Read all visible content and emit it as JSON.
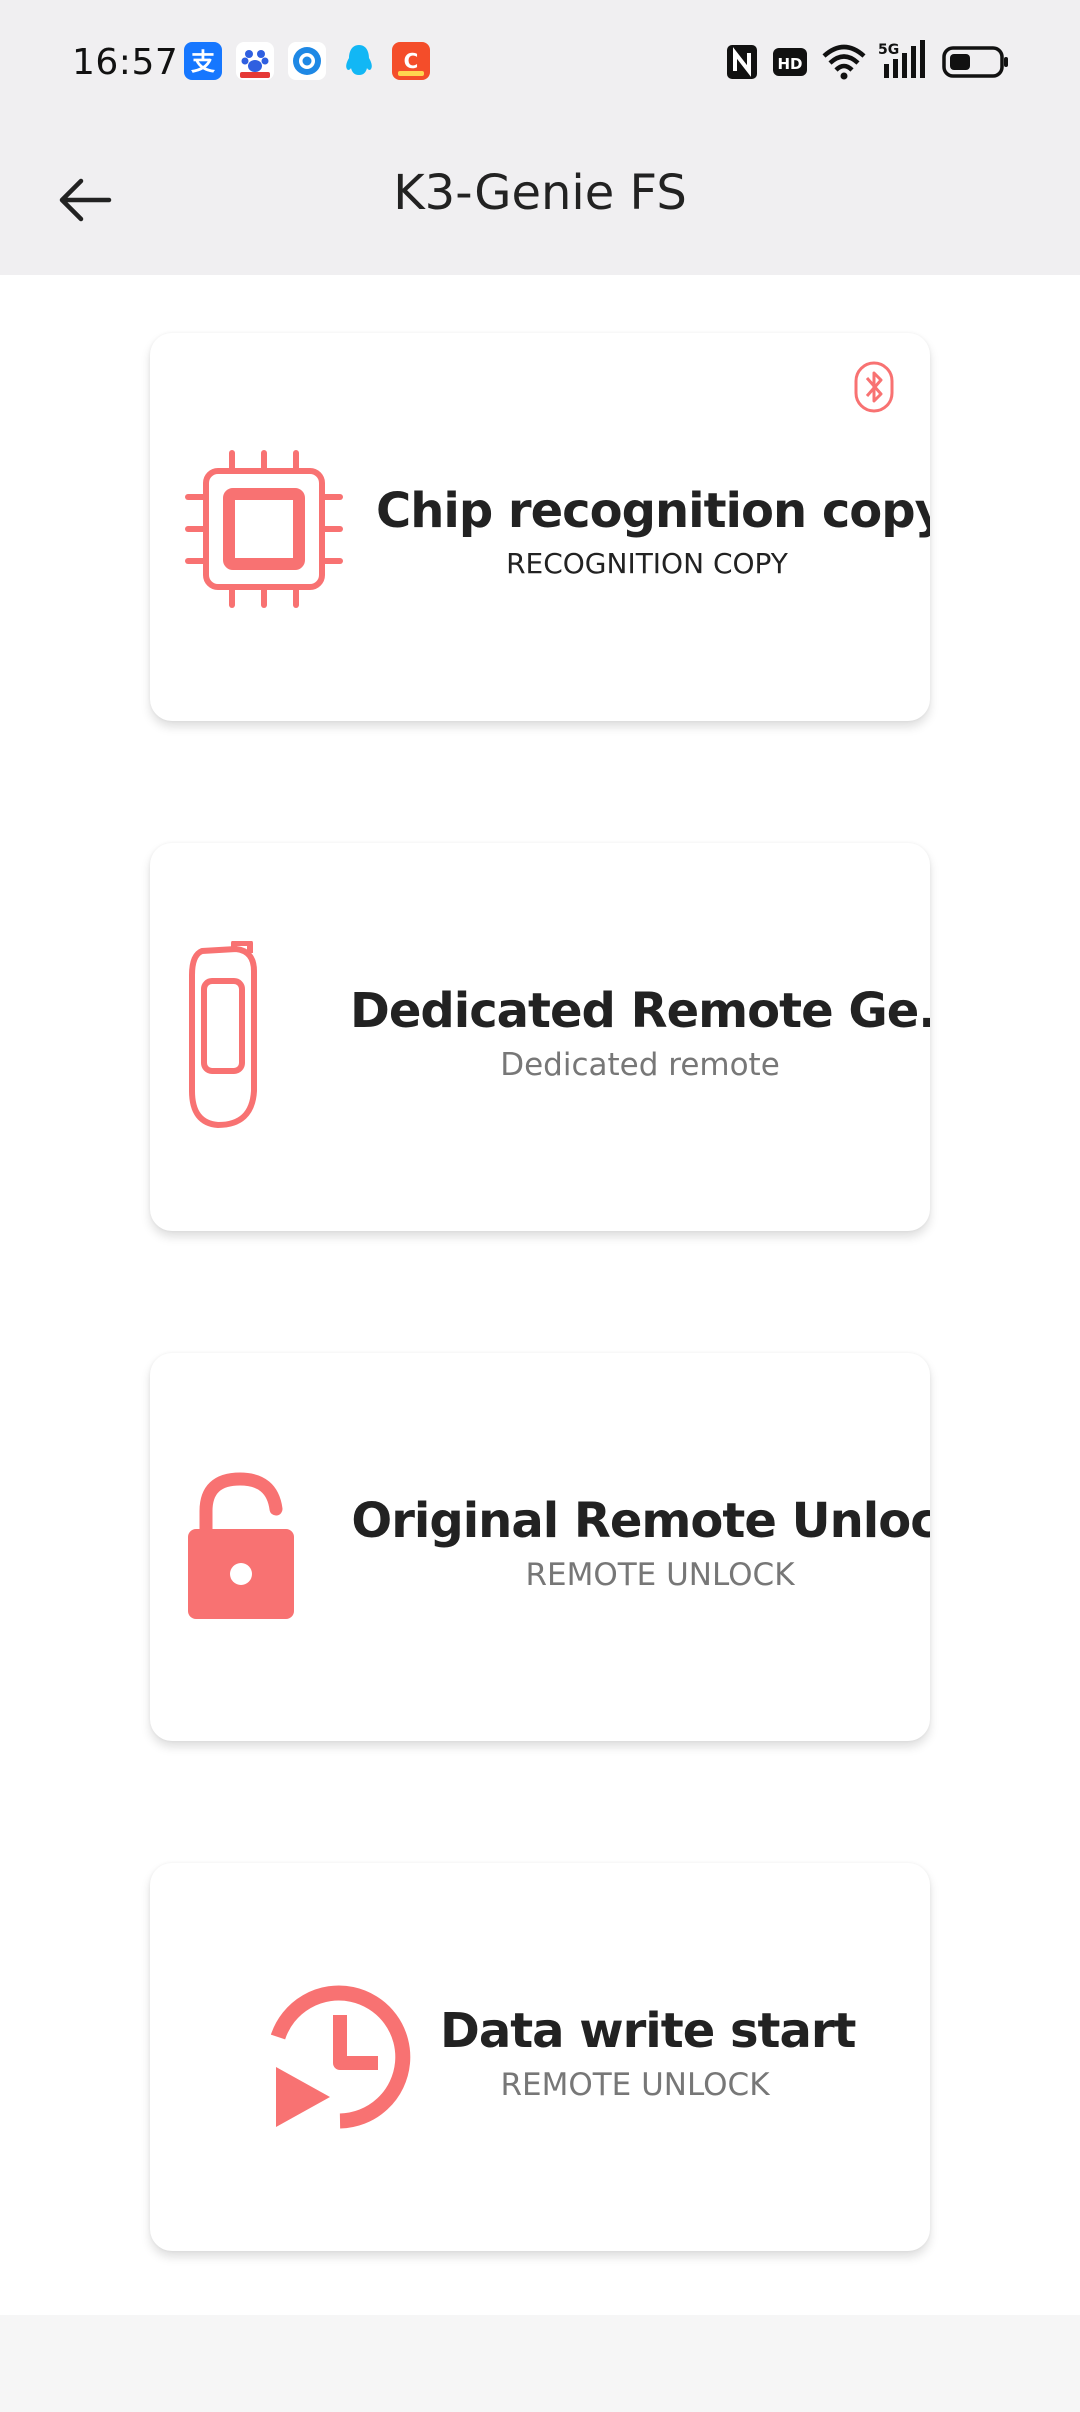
{
  "status_bar": {
    "time": "16:57",
    "notification_icons": [
      "alipay-icon",
      "baidu-icon",
      "circle-app-icon",
      "qq-icon",
      "shopping-app-icon"
    ],
    "system_icons": [
      "nfc-icon",
      "hd-icon",
      "wifi-icon",
      "5g-signal-icon",
      "battery-icon"
    ]
  },
  "app_bar": {
    "title": "K3-Genie FS"
  },
  "colors": {
    "accent": "#f87272",
    "background": "#ffffff",
    "bar": "#f0eff1"
  },
  "cards": [
    {
      "title": "Chip recognition copy",
      "subtitle": "RECOGNITION COPY",
      "icon": "chip-icon",
      "badge_icon": "bluetooth-icon"
    },
    {
      "title": "Dedicated Remote Ge...",
      "subtitle": "Dedicated remote",
      "icon": "remote-key-icon"
    },
    {
      "title": "Original Remote Unlock",
      "subtitle": "REMOTE UNLOCK",
      "icon": "unlock-icon"
    },
    {
      "title": "Data write start",
      "subtitle": "REMOTE UNLOCK",
      "icon": "timer-play-icon"
    }
  ]
}
